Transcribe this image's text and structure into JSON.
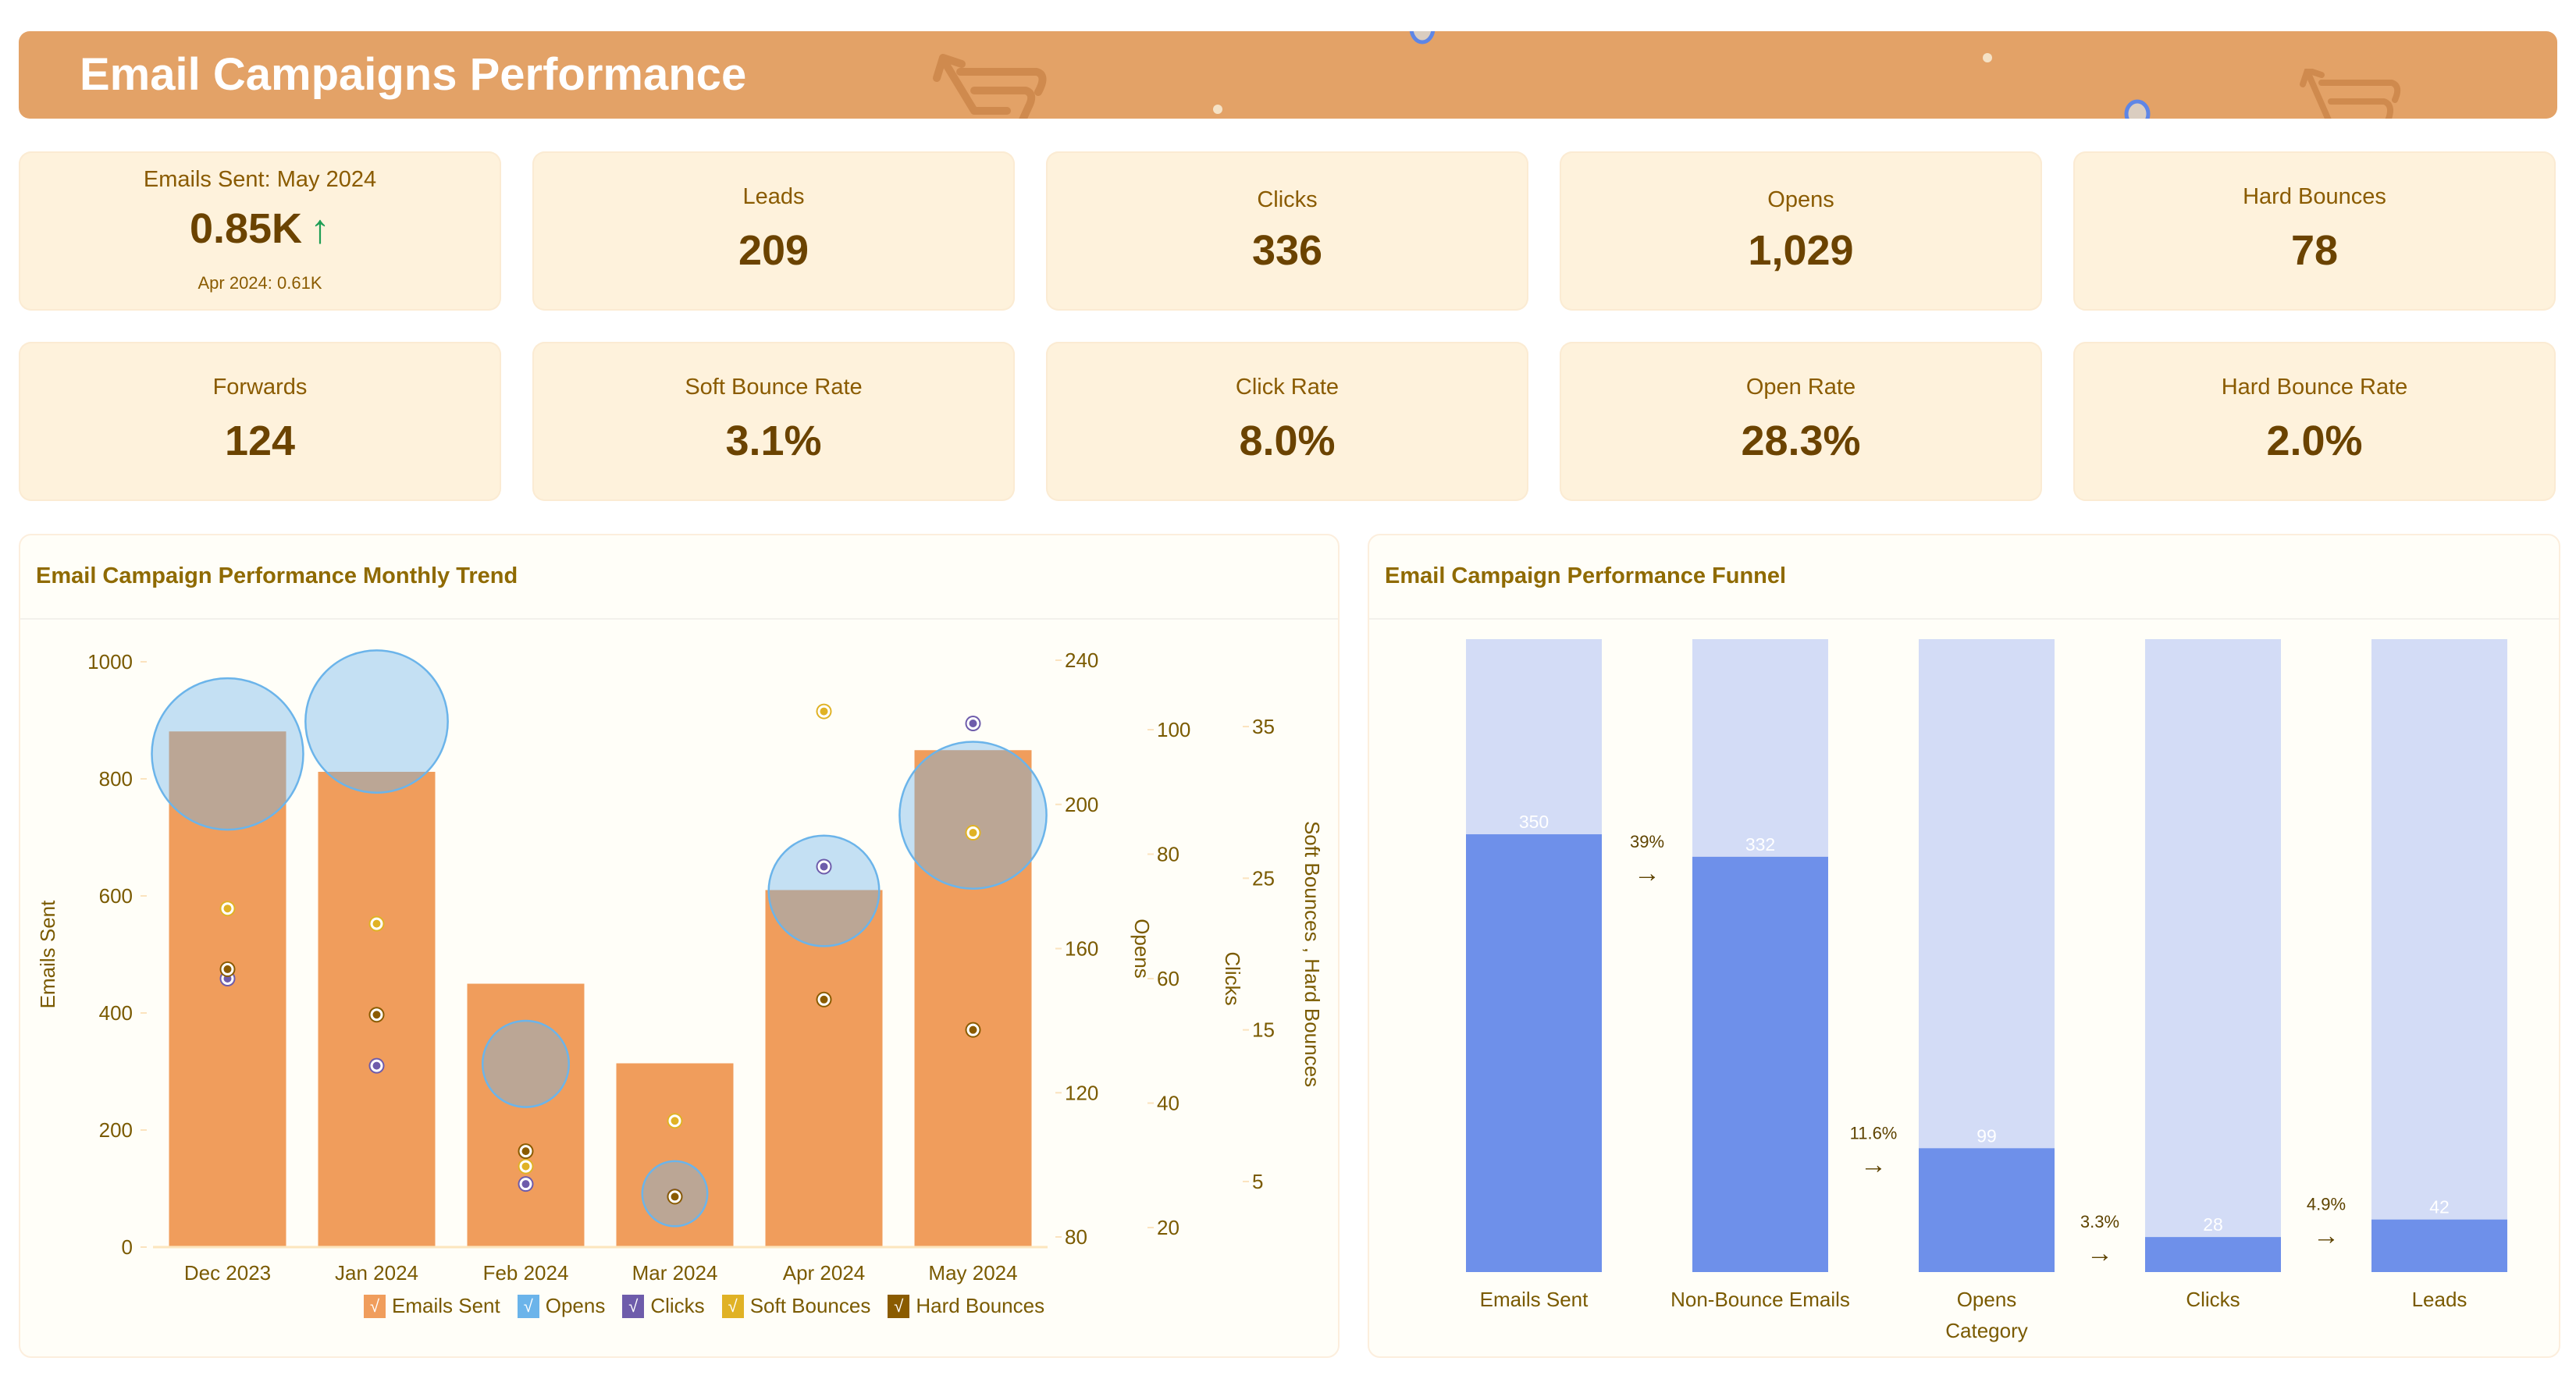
{
  "header": {
    "title": "Email Campaigns Performance"
  },
  "kpis_row1": [
    {
      "label": "Emails Sent: May 2024",
      "value": "0.85K",
      "trend_icon": "arrow-up",
      "trend_symbol": "↑",
      "trend_color": "#1E9E55",
      "comparison": "Apr 2024: 0.61K"
    },
    {
      "label": "Leads",
      "value": "209"
    },
    {
      "label": "Clicks",
      "value": "336"
    },
    {
      "label": "Opens",
      "value": "1,029"
    },
    {
      "label": "Hard Bounces",
      "value": "78"
    }
  ],
  "kpis_row2": [
    {
      "label": "Forwards",
      "value": "124"
    },
    {
      "label": "Soft Bounce Rate",
      "value": "3.1%"
    },
    {
      "label": "Click Rate",
      "value": "8.0%"
    },
    {
      "label": "Open Rate",
      "value": "28.3%"
    },
    {
      "label": "Hard Bounce Rate",
      "value": "2.0%"
    }
  ],
  "trend_panel": {
    "title": "Email Campaign Performance Monthly Trend"
  },
  "funnel_panel": {
    "title": "Email Campaign Performance Funnel"
  },
  "colors": {
    "header": "#E3A267",
    "emails_sent": "#F09D5C",
    "opens": "#6BB4EA",
    "clicks": "#6E5CAB",
    "soft_bounces": "#E0B225",
    "hard_bounces": "#8A5B00",
    "funnel_fill": "#6E90EA",
    "funnel_bg": "#D3DCF6"
  },
  "chart_data": [
    {
      "type": "bar",
      "title": "Email Campaign Performance Monthly Trend",
      "categories": [
        "Dec 2023",
        "Jan 2024",
        "Feb 2024",
        "Mar 2024",
        "Apr 2024",
        "May 2024"
      ],
      "axes": {
        "y_left": {
          "label": "Emails Sent",
          "range": [
            0,
            1000
          ],
          "ticks": [
            "0",
            "200",
            "400",
            "600",
            "800",
            "1000"
          ],
          "tick_values": [
            0,
            200,
            400,
            600,
            800,
            1000
          ]
        },
        "y_opens": {
          "label": "Opens",
          "range": [
            80,
            240
          ],
          "ticks": [
            "80",
            "120",
            "160",
            "200",
            "240"
          ],
          "tick_values": [
            80,
            120,
            160,
            200,
            240
          ]
        },
        "y_clicks": {
          "label": "Clicks",
          "range": [
            20,
            100
          ],
          "ticks": [
            "20",
            "40",
            "60",
            "80",
            "100"
          ],
          "tick_values": [
            20,
            40,
            60,
            80,
            100
          ]
        },
        "y_bounces": {
          "label": "Soft Bounces , Hard Bounces",
          "range": [
            5,
            35
          ],
          "ticks": [
            "5",
            "15",
            "25",
            "35"
          ],
          "tick_values": [
            5,
            15,
            25,
            35
          ]
        }
      },
      "series": [
        {
          "name": "Emails Sent",
          "type": "bar",
          "axis": "y_left",
          "color": "#F09D5C",
          "values": [
            881,
            812,
            450,
            314,
            610,
            849
          ]
        },
        {
          "name": "Opens",
          "type": "bubble",
          "axis": "y_opens",
          "color": "#6BB4EA",
          "values": [
            214,
            223,
            128,
            92,
            176,
            197
          ],
          "relative_size": [
            1.0,
            0.94,
            0.57,
            0.43,
            0.73,
            0.97
          ]
        },
        {
          "name": "Clicks",
          "type": "scatter",
          "axis": "y_clicks",
          "color": "#6E5CAB",
          "values": [
            60,
            46,
            27,
            25,
            78,
            101
          ]
        },
        {
          "name": "Soft Bounces",
          "type": "scatter",
          "axis": "y_bounces",
          "color": "#E0B225",
          "values": [
            23,
            22,
            6,
            9,
            36,
            28
          ]
        },
        {
          "name": "Hard Bounces",
          "type": "scatter",
          "axis": "y_bounces",
          "color": "#8A5B00",
          "values": [
            19,
            16,
            7,
            4,
            17,
            15
          ]
        }
      ],
      "legend": {
        "placement": "bottom",
        "items": [
          "Emails Sent",
          "Opens",
          "Clicks",
          "Soft Bounces",
          "Hard Bounces"
        ],
        "check_symbol": "√"
      },
      "grid": false
    },
    {
      "type": "bar",
      "subtype": "funnel",
      "title": "Email Campaign Performance Funnel",
      "xlabel": "Category",
      "categories": [
        "Emails Sent",
        "Non-Bounce Emails",
        "Opens",
        "Clicks",
        "Leads"
      ],
      "values": [
        350,
        332,
        99,
        28,
        42
      ],
      "scale_max": 506,
      "conversions": [
        "39%",
        "11.6%",
        "3.3%",
        "4.9%"
      ],
      "arrow_symbol": "→"
    }
  ]
}
